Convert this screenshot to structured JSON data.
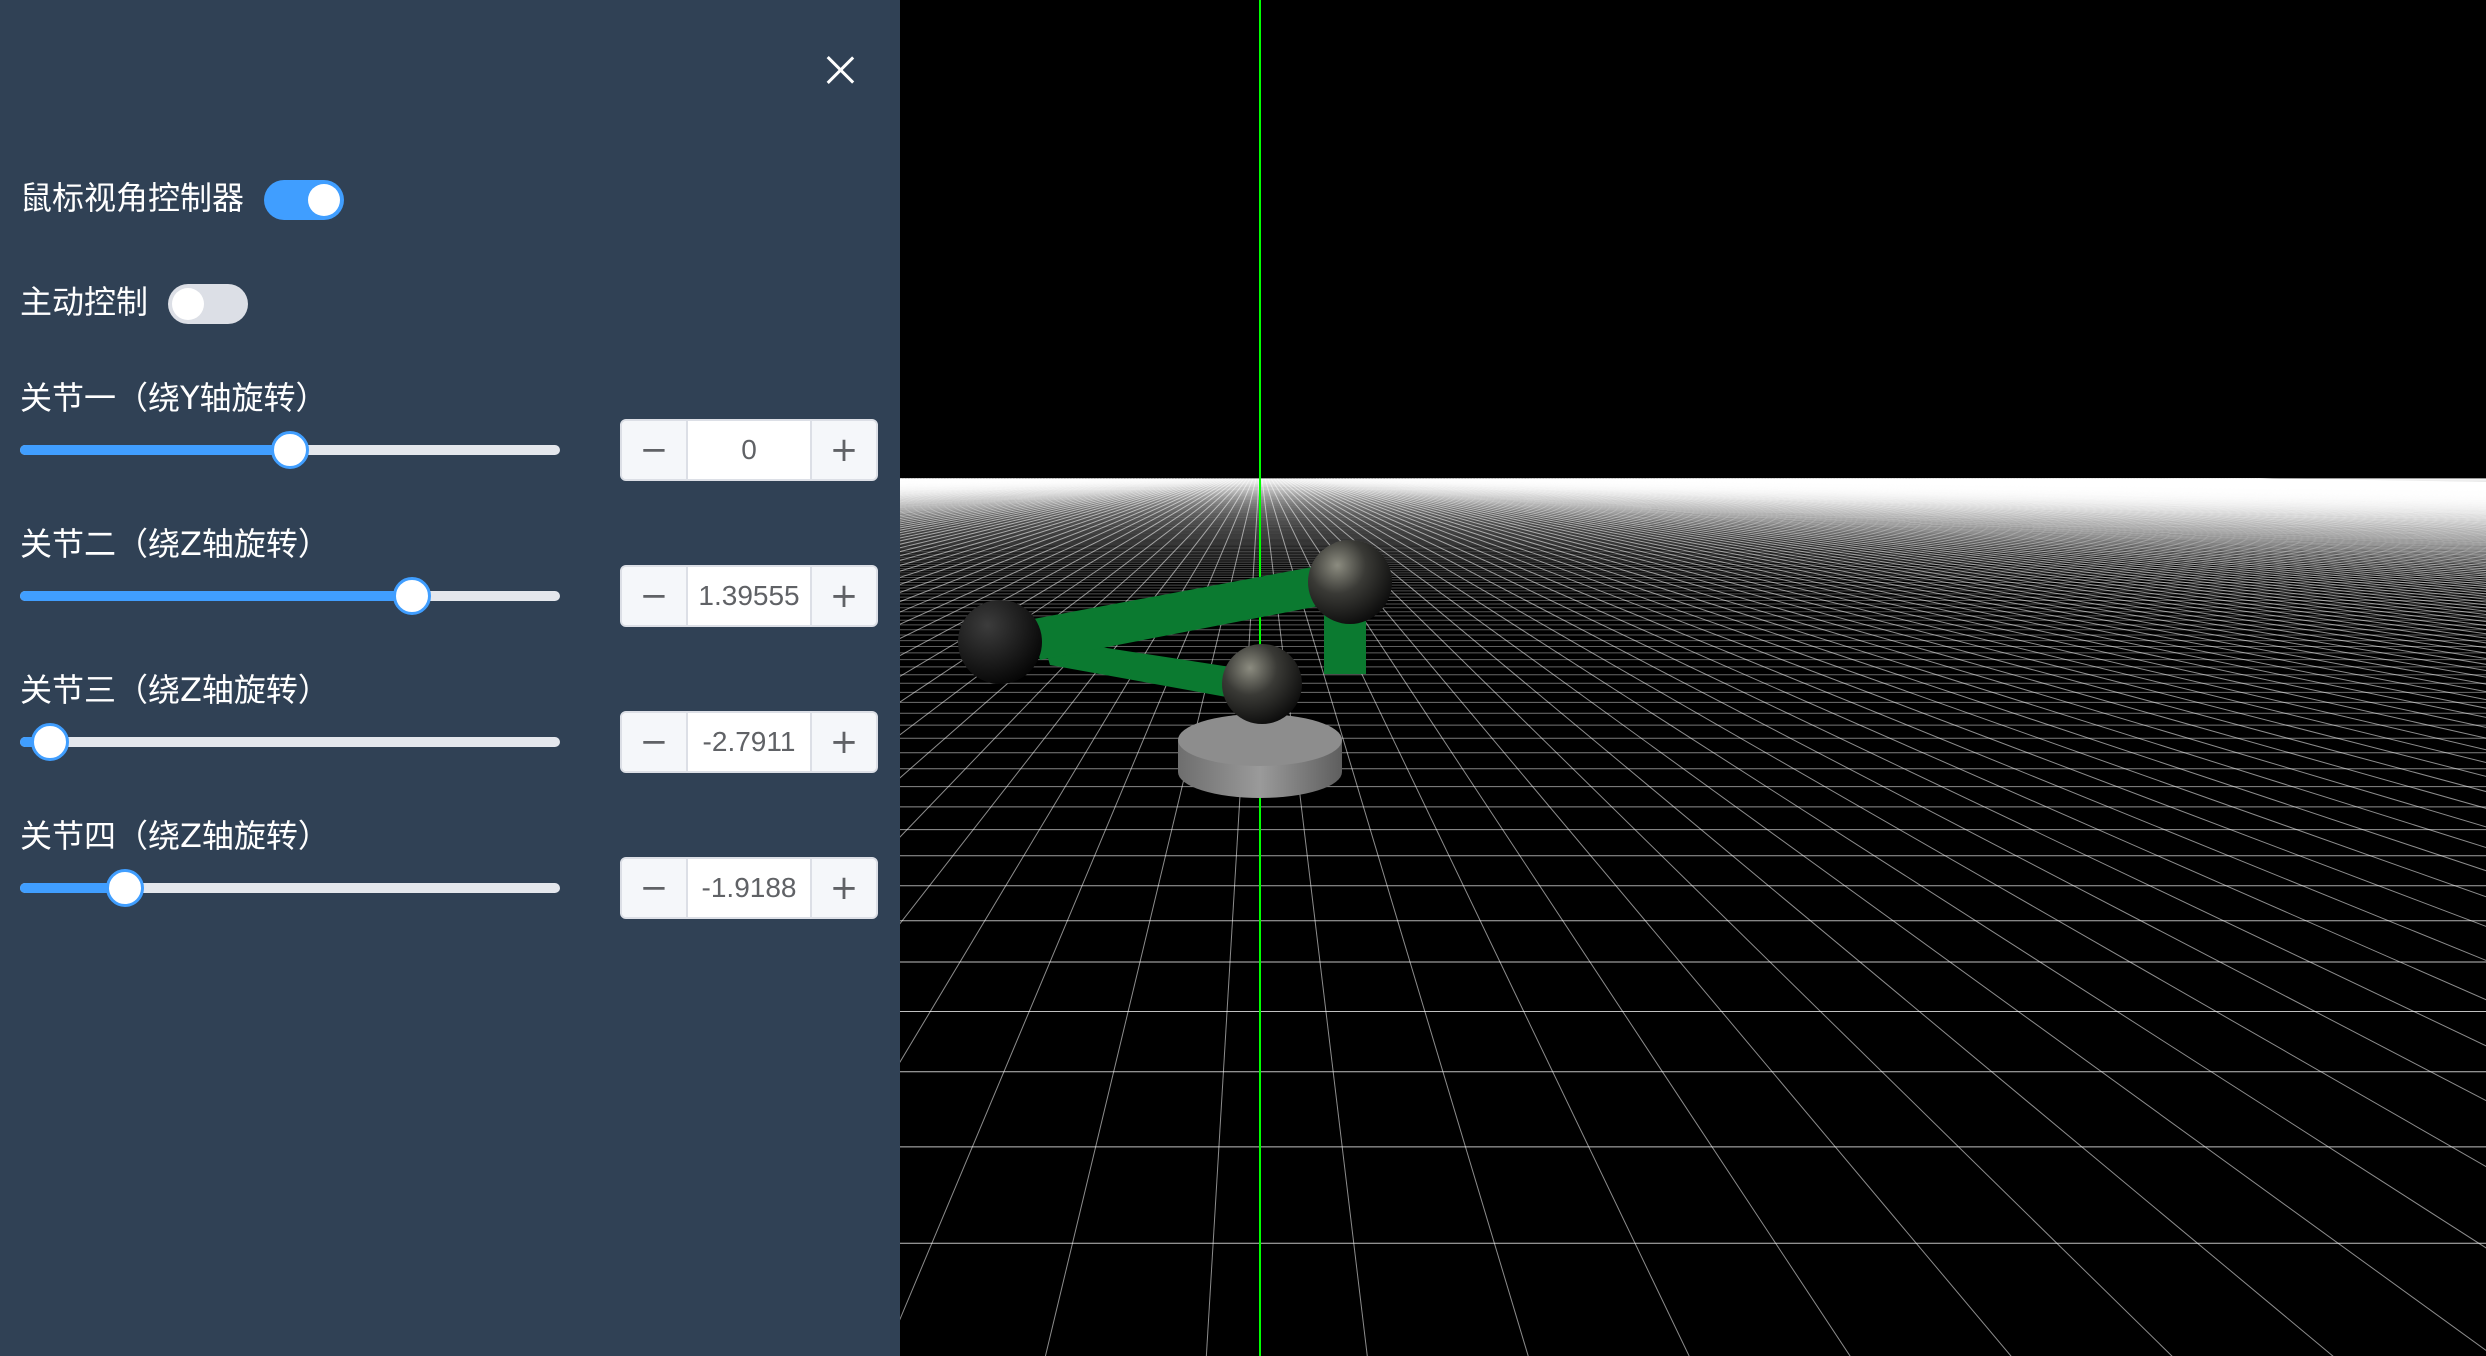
{
  "panel": {
    "mouse_view_control": {
      "label": "鼠标视角控制器",
      "on": true
    },
    "active_control": {
      "label": "主动控制",
      "on": false
    },
    "joints": [
      {
        "label": "关节一（绕Y轴旋转）",
        "value": "0",
        "fraction": 0.5
      },
      {
        "label": "关节二（绕Z轴旋转）",
        "value": "1.39555",
        "fraction": 0.725
      },
      {
        "label": "关节三（绕Z轴旋转）",
        "value": "-2.7911",
        "fraction": 0.056
      },
      {
        "label": "关节四（绕Z轴旋转）",
        "value": "-1.9188",
        "fraction": 0.195
      }
    ],
    "minus_symbol": "−",
    "plus_symbol": "+"
  },
  "viewport": {
    "background": "#000000",
    "grid_color": "#ffffff",
    "axis_color": "#00ff00",
    "arm_color": "#0b7a30",
    "joint_color": "#2a2a2a",
    "base_color": "#8a8a8a"
  },
  "colors": {
    "panel_bg": "#304155",
    "accent": "#409eff",
    "switch_off": "#dcdfe6"
  }
}
